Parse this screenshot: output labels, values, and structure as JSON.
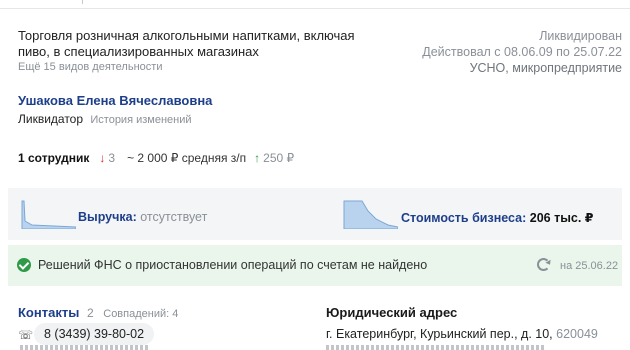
{
  "activity": {
    "main_text": "Торговля розничная алкогольными напитками, включая пиво, в специализированных магазинах",
    "more_link": "Ещё 15 видов деятельности"
  },
  "status": {
    "state": "Ликвидирован",
    "period": "Действовал с 08.06.09 по 25.07.22",
    "tax_regime": "УСНО, микропредприятие"
  },
  "person": {
    "name": "Ушакова Елена Вячеславовна",
    "role": "Ликвидатор",
    "history_link": "История изменений"
  },
  "employees": {
    "count_label": "1 сотрудник",
    "down_arrow": "↓",
    "down_value": "3",
    "salary_label": "~ 2 000 ₽ средняя з/п",
    "up_arrow": "↑",
    "up_value": "250 ₽"
  },
  "finance": {
    "revenue_label": "Выручка:",
    "revenue_value": "отсутствует",
    "business_value_label": "Стоимость бизнеса:",
    "business_value": "206 тыс. ₽"
  },
  "fns": {
    "message": "Решений ФНС о приостановлении операций по счетам не найдено",
    "date": "на 25.06.22"
  },
  "contacts": {
    "title": "Контакты",
    "count": "2",
    "matches": "Совпадений: 4",
    "phone": "8 (3439) 39-80-02"
  },
  "address": {
    "title": "Юридический адрес",
    "text": "г. Екатеринбург, Курьинский пер., д. 10,",
    "zip": "620049"
  },
  "colors": {
    "link_blue": "#1d3f8a",
    "muted_gray": "#8a9097",
    "success_green": "#2f9a47",
    "down_red": "#d92b2b",
    "sparkline_fill": "#b9d3ee"
  },
  "icons": {
    "fns_status": "check-circle-icon",
    "refresh": "refresh-icon",
    "phone": "phone-icon"
  }
}
